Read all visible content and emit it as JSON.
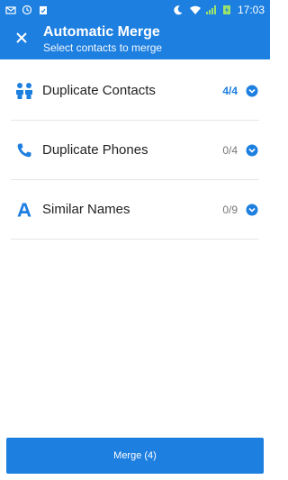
{
  "status_bar": {
    "time": "17:03",
    "icons": [
      "mail-icon",
      "clock-icon",
      "task-icon",
      "moon-icon",
      "wifi-icon",
      "signal-icon",
      "battery-charging-icon"
    ]
  },
  "app_bar": {
    "title": "Automatic Merge",
    "subtitle": "Select contacts to merge"
  },
  "categories": [
    {
      "label": "Duplicate Contacts",
      "count": "4/4",
      "icon": "people-icon",
      "active": true
    },
    {
      "label": "Duplicate Phones",
      "count": "0/4",
      "icon": "phone-icon",
      "active": false
    },
    {
      "label": "Similar Names",
      "count": "0/9",
      "icon": "letter-a-icon",
      "active": false
    }
  ],
  "merge_button": {
    "label": "Merge (4)"
  },
  "colors": {
    "accent": "#1d7fe0"
  }
}
